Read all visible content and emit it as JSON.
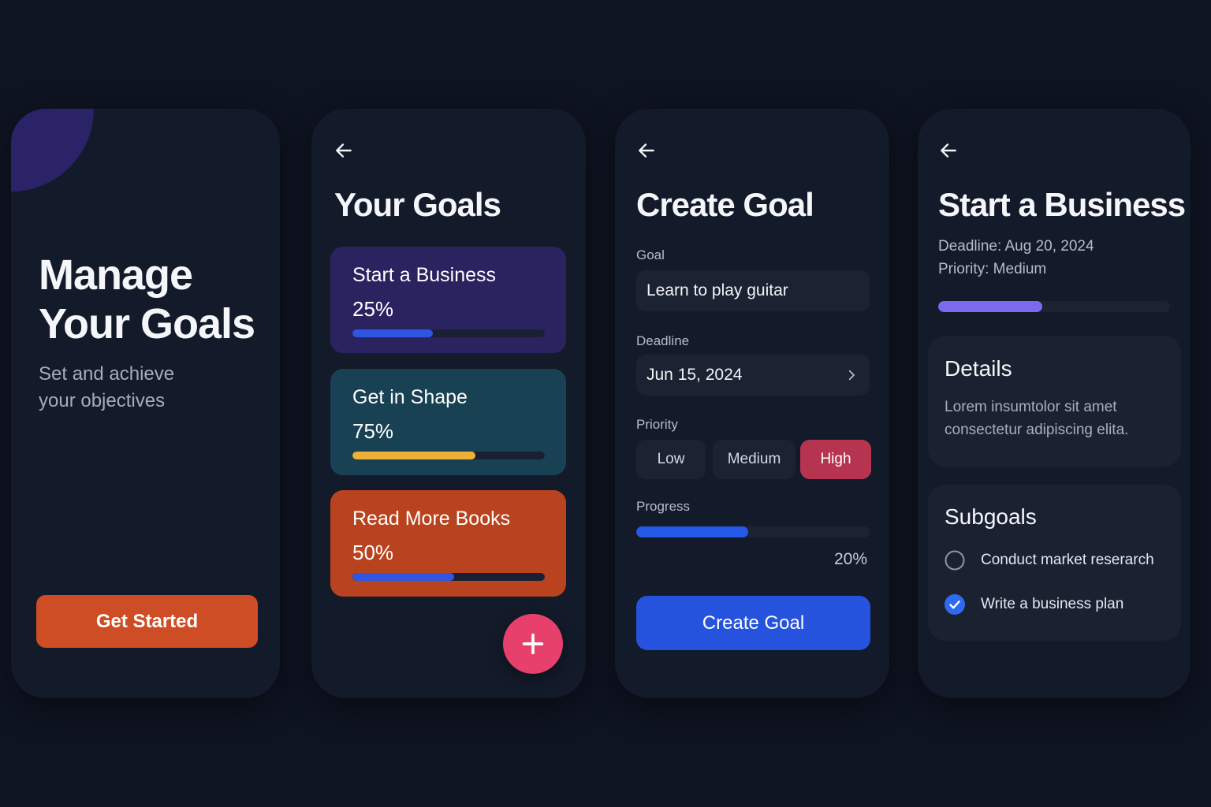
{
  "colors": {
    "background": "#0f1422",
    "card": "#131a29",
    "primary_orange": "#ce4d24",
    "accent_pink": "#e8406c",
    "accent_blue": "#2553dd",
    "priority_high": "#b73451",
    "detail_progress": "#7b6af0"
  },
  "welcome": {
    "title_line1": "Manage",
    "title_line2": "Your Goals",
    "subtitle_line1": "Set and achieve",
    "subtitle_line2": "your objectives",
    "cta": "Get Started"
  },
  "goals_list": {
    "back_icon": "arrow-left-icon",
    "title": "Your Goals",
    "goals": [
      {
        "name": "Start a Business",
        "percent_label": "25%",
        "progress": 0.42,
        "card_color": "#2b2260",
        "bar_color": "#2f56e0"
      },
      {
        "name": "Get in Shape",
        "percent_label": "75%",
        "progress": 0.64,
        "card_color": "#184254",
        "bar_color": "#efb03a"
      },
      {
        "name": "Read More Books",
        "percent_label": "50%",
        "progress": 0.53,
        "card_color": "#b9431f",
        "bar_color": "#2f56e0"
      }
    ],
    "fab_icon": "plus-icon"
  },
  "create_goal": {
    "back_icon": "arrow-left-icon",
    "title": "Create Goal",
    "goal_label": "Goal",
    "goal_value": "Learn to play guitar",
    "deadline_label": "Deadline",
    "deadline_value": "Jun 15, 2024",
    "deadline_icon": "chevron-right-icon",
    "priority_label": "Priority",
    "priority_options": [
      "Low",
      "Medium",
      "High"
    ],
    "priority_selected": "High",
    "progress_label": "Progress",
    "progress_value": 0.48,
    "progress_text": "20%",
    "submit": "Create Goal"
  },
  "goal_detail": {
    "back_icon": "arrow-left-icon",
    "title": "Start a Business",
    "deadline": "Deadline: Aug 20, 2024",
    "priority": "Priority: Medium",
    "progress": 0.45,
    "details_heading": "Details",
    "details_body": "Lorem insumtolor sit amet consectetur adipiscing elita.",
    "subgoals_heading": "Subgoals",
    "subgoals": [
      {
        "label": "Conduct market reserarch",
        "done": false
      },
      {
        "label": "Write a business plan",
        "done": true
      }
    ]
  }
}
